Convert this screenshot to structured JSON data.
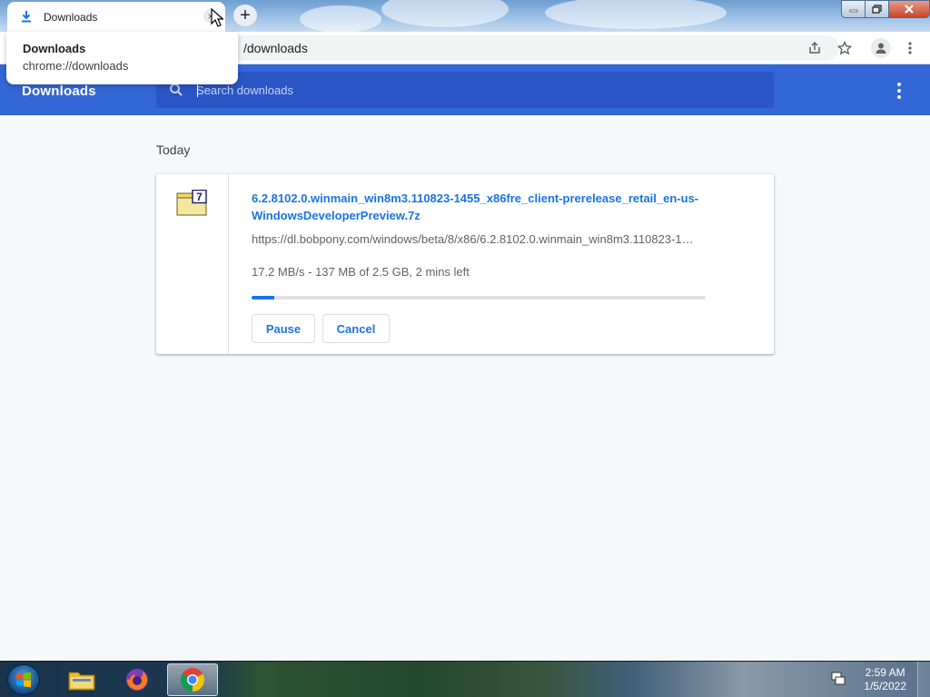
{
  "browser": {
    "tab": {
      "title": "Downloads",
      "favicon": "download-icon",
      "close_icon": "close-icon"
    },
    "new_tab_icon": "plus-icon",
    "hovercard": {
      "title": "Downloads",
      "url": "chrome://downloads"
    },
    "omnibox": {
      "visible_text": "/downloads"
    },
    "toolbar_icons": [
      "share-icon",
      "star-icon",
      "profile-icon",
      "menu-icon"
    ],
    "window_controls": [
      "minimize",
      "restore",
      "close"
    ]
  },
  "downloads_page": {
    "title": "Downloads",
    "search": {
      "placeholder": "Search downloads",
      "value": ""
    },
    "section_label": "Today",
    "item": {
      "file_name": "6.2.8102.0.winmain_win8m3.110823-1455_x86fre_client-prerelease_retail_en-us-WindowsDeveloperPreview.7z",
      "url": "https://dl.bobpony.com/windows/beta/8/x86/6.2.8102.0.winmain_win8m3.110823-1…",
      "status": "17.2 MB/s - 137 MB of 2.5 GB, 2 mins left",
      "progress_fraction": 0.05,
      "pause_label": "Pause",
      "cancel_label": "Cancel",
      "file_icon": "7z-archive-icon"
    }
  },
  "taskbar": {
    "apps": [
      "file-explorer",
      "firefox",
      "chrome"
    ],
    "active_app": "chrome",
    "clock": {
      "time": "2:59 AM",
      "date": "1/5/2022"
    }
  },
  "colors": {
    "header_blue": "#3367d6",
    "search_blue": "#2a56c6",
    "link_blue": "#1a73e8",
    "page_bg": "#f6f9fc"
  }
}
